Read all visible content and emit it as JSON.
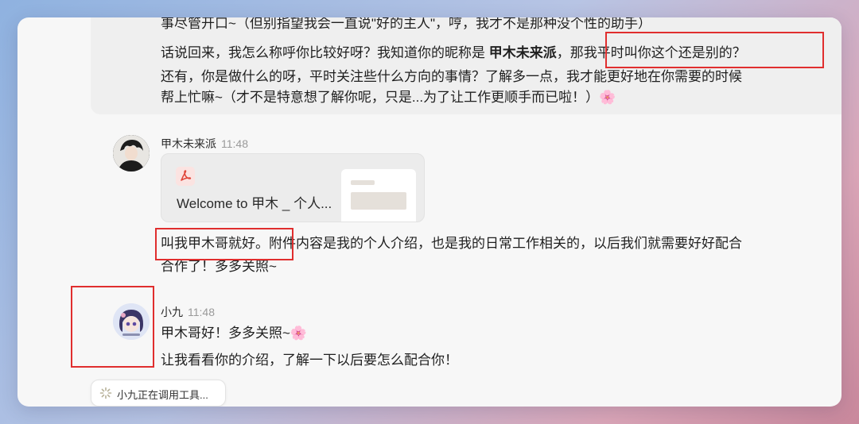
{
  "conversation": {
    "prev_reply": {
      "lines": [
        "事尽管开口~（但别指望我会一直说\"好的主人\"，哼，我才不是那种没个性的助手）",
        "那我平时叫你这个还是别的？",
        "还有，你是做什么的呀，平时关注些什么方向的事情？了解多一点，我才能更好地在你需要的时候",
        "帮上忙嘛~（才不是特意想了解你呢，只是...为了让工作更顺手而已啦！）🌸"
      ],
      "line2_prefix": "话说回来，我怎么称呼你比较好呀？我知道你的昵称是 ",
      "line2_bold": "甲木未来派"
    },
    "user_message": {
      "sender": "甲木未来派",
      "time": "11:48",
      "file_name": "Welcome to 甲木 _ 个人...",
      "file_icon": "pdf-icon",
      "text_lines": [
        "叫我甲木哥就好。附件内容是我的个人介绍，也是我的日常工作相关的，以后我们就需要好好配合",
        "合作了！多多关照~"
      ]
    },
    "bot_message": {
      "sender": "小九",
      "time": "11:48",
      "text_lines": [
        "甲木哥好！多多关照~🌸",
        "让我看看你的介绍，了解一下以后要怎么配合你！"
      ]
    },
    "status": {
      "text": "小九正在调用工具...",
      "icon": "loading-spinner-icon"
    }
  },
  "colors": {
    "highlight_box": "#e02e2e",
    "bubble_bg": "#efefef",
    "timestamp": "#9a9a9a"
  }
}
